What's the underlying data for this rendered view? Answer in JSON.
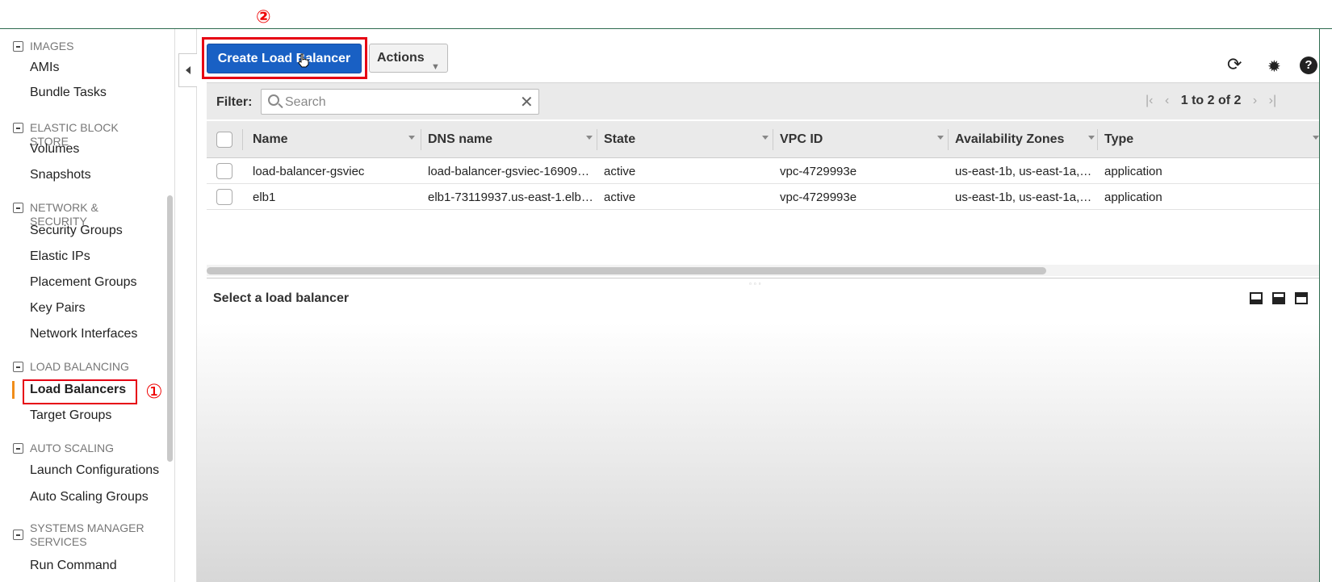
{
  "annotations": {
    "step1": "①",
    "step2": "②"
  },
  "sidebar": {
    "sections": [
      {
        "title": "IMAGES",
        "items": [
          "AMIs",
          "Bundle Tasks"
        ]
      },
      {
        "title": "ELASTIC BLOCK STORE",
        "items": [
          "Volumes",
          "Snapshots"
        ]
      },
      {
        "title": "NETWORK & SECURITY",
        "items": [
          "Security Groups",
          "Elastic IPs",
          "Placement Groups",
          "Key Pairs",
          "Network Interfaces"
        ]
      },
      {
        "title": "LOAD BALANCING",
        "items": [
          "Load Balancers",
          "Target Groups"
        ]
      },
      {
        "title": "AUTO SCALING",
        "items": [
          "Launch Configurations",
          "Auto Scaling Groups"
        ]
      },
      {
        "title": "SYSTEMS MANAGER SERVICES",
        "items": [
          "Run Command"
        ]
      }
    ],
    "active_item": "Load Balancers"
  },
  "toolbar": {
    "create_label": "Create Load Balancer",
    "actions_label": "Actions"
  },
  "filter": {
    "label": "Filter:",
    "placeholder": "Search",
    "pager_text": "1 to 2 of 2"
  },
  "table": {
    "columns": [
      "Name",
      "DNS name",
      "State",
      "VPC ID",
      "Availability Zones",
      "Type"
    ],
    "rows": [
      [
        "load-balancer-gsviec",
        "load-balancer-gsviec-16909…",
        "active",
        "vpc-4729993e",
        "us-east-1b, us-east-1a,…",
        "application"
      ],
      [
        "elb1",
        "elb1-73119937.us-east-1.elb…",
        "active",
        "vpc-4729993e",
        "us-east-1b, us-east-1a,…",
        "application"
      ]
    ]
  },
  "detail": {
    "title": "Select a load balancer"
  },
  "colors": {
    "primary_button": "#1960c4",
    "highlight": "#e60012",
    "active_marker": "#f08d1a"
  }
}
